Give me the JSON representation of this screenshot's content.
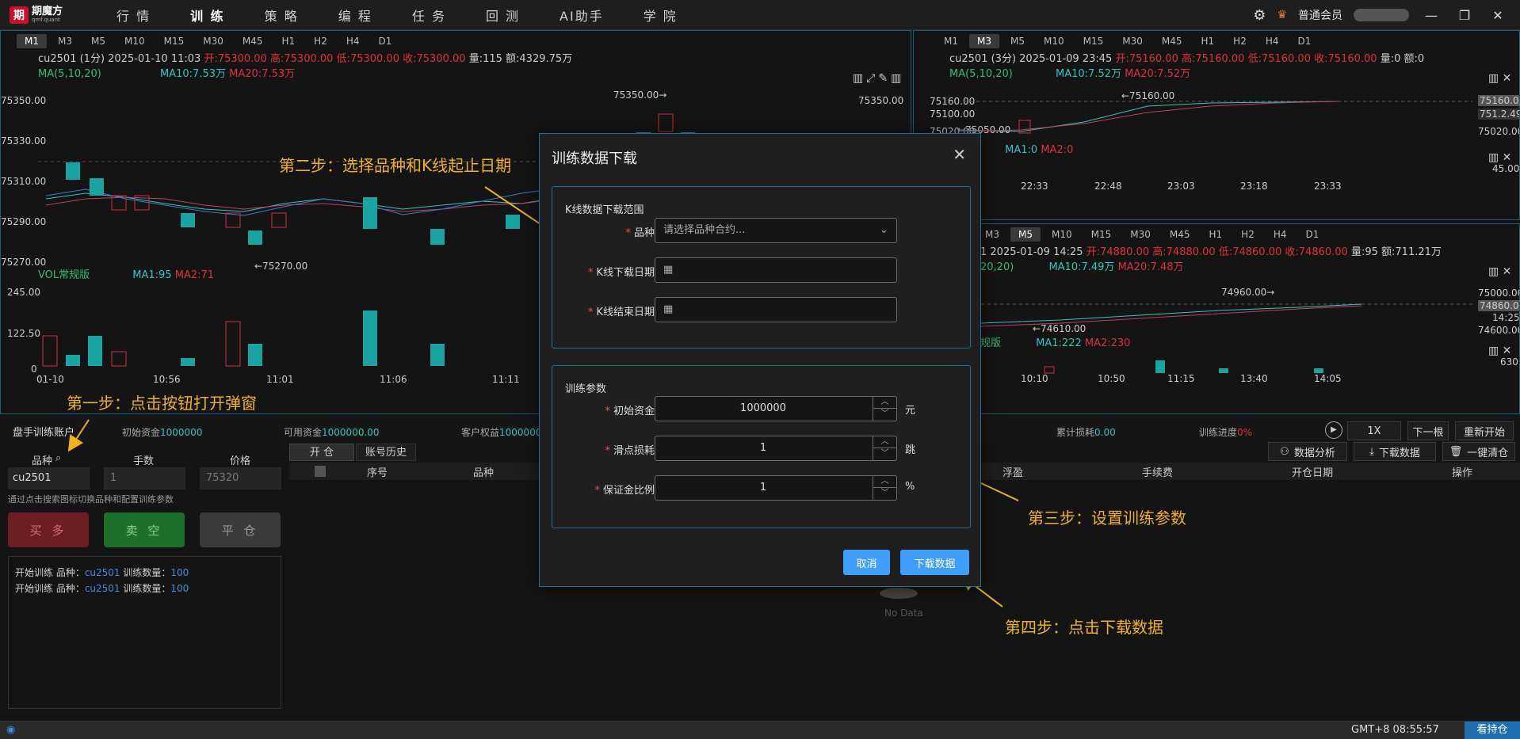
{
  "app": {
    "name": "期魔方",
    "subtitle": "qmf.quant"
  },
  "nav": [
    {
      "label": "行 情"
    },
    {
      "label": "训 练"
    },
    {
      "label": "策 略"
    },
    {
      "label": "编 程"
    },
    {
      "label": "任 务"
    },
    {
      "label": "回 测"
    },
    {
      "label": "AI助手"
    },
    {
      "label": "学 院"
    }
  ],
  "topRight": {
    "member": "普通会员",
    "minimize": "—",
    "maximize": "❐",
    "close": "✕"
  },
  "chartMain": {
    "timeframes": [
      "M1",
      "M3",
      "M5",
      "M10",
      "M15",
      "M30",
      "M45",
      "H1",
      "H2",
      "H4",
      "D1"
    ],
    "info": "cu2501  (1分)  2025-01-10  11:03",
    "open": "开:75300.00",
    "high": "高:75300.00",
    "low": "低:75300.00",
    "close": "收:75300.00",
    "vol": "量:115",
    "amt": "额:4329.75万",
    "ma_label": "MA(5,10,20)",
    "ma10": "MA10:7.53万",
    "ma20": "MA20:7.53万",
    "y": [
      "75350.00",
      "75330.00",
      "75310.00",
      "75290.00",
      "75270.00"
    ],
    "peak": "75350.00→",
    "trough": "←75270.00",
    "rightTop": "75350.00",
    "vol_label": "VOL常规版",
    "vol_ma1": "MA1:95",
    "vol_ma2": "MA2:71",
    "vy": [
      "245.00",
      "122.50",
      "0"
    ],
    "x": [
      "01-10",
      "10:56",
      "11:01",
      "11:06",
      "11:11"
    ]
  },
  "chartTR": {
    "timeframes": [
      "M1",
      "M3",
      "M5",
      "M10",
      "M15",
      "M30",
      "M45",
      "H1",
      "H2",
      "H4",
      "D1"
    ],
    "info": "cu2501  (3分)  2025-01-09  23:45",
    "open": "开:75160.00",
    "high": "高:75160.00",
    "low": "低:75160.00",
    "close": "收:75160.00",
    "vol": "量:0",
    "amt": "额:0",
    "ma_label": "MA(5,10,20)",
    "ma10": "MA10:7.52万",
    "ma20": "MA20:7.52万",
    "y": [
      "75160.00",
      "75100.00",
      "75020.00"
    ],
    "ry": [
      "75160.00",
      "751.2.49",
      "75020.00"
    ],
    "peak": "←75160.00",
    "trough": "←75050.00",
    "vol_label": "规版",
    "vol_ma1": "MA1:0",
    "vol_ma2": "MA2:0",
    "vr": "45.00",
    "x": [
      "22:33",
      "22:48",
      "23:03",
      "23:18",
      "23:33"
    ]
  },
  "chartBR": {
    "timeframes": [
      "M3",
      "M5",
      "M10",
      "M15",
      "M30",
      "M45",
      "H1",
      "H2",
      "H4",
      "D1"
    ],
    "info": "1  2025-01-09  14:25",
    "open": "开:74880.00",
    "high": "高:74880.00",
    "low": "低:74860.00",
    "close": "收:74860.00",
    "vol": "量:95",
    "amt": "额:711.21万",
    "ma_label": "20,20)",
    "ma10": "MA10:7.49万",
    "ma20": "MA20:7.48万",
    "ry": [
      "75000.00",
      "74860.00",
      "14:25",
      "74600.00"
    ],
    "peak": "74960.00→",
    "trough": "←74610.00",
    "vol_label": "规版",
    "vol_ma1": "MA1:222",
    "vol_ma2": "MA2:230",
    "vr": "630",
    "x": [
      "10:10",
      "10:50",
      "11:15",
      "13:40",
      "14:05"
    ]
  },
  "annotations": {
    "step1": "第一步：点击按钮打开弹窗",
    "step2": "第二步：选择品种和K线起止日期",
    "step3": "第三步：设置训练参数",
    "step4": "第四步：点击下载数据"
  },
  "account": {
    "title": "盘手训练账户",
    "init_label": "初始资金",
    "init": "1000000",
    "avail_label": "可用资金",
    "avail": "1000000.00",
    "equity_label": "客户权益",
    "equity": "1000000",
    "loss_label": "累计损耗",
    "loss": "0.00",
    "progress_label": "训练进度",
    "progress": "0%"
  },
  "controls": {
    "speed": "1X",
    "next": "下一根",
    "restart": "重新开始"
  },
  "order": {
    "symbol_label": "品种",
    "qty_label": "手数",
    "price_label": "价格",
    "symbol": "cu2501",
    "qty": "1",
    "price": "75320",
    "hint": "通过点击搜索图标切换品种和配置训练参数",
    "buy": "买 多",
    "sell": "卖 空",
    "close": "平 仓"
  },
  "log": [
    {
      "prefix": "开始训练 品种：",
      "sym": "cu2501",
      "mid": " 训练数量：",
      "n": "100"
    },
    {
      "prefix": "开始训练 品种：",
      "sym": "cu2501",
      "mid": " 训练数量：",
      "n": "100"
    }
  ],
  "tabs": {
    "open": "开 仓",
    "history": "账号历史"
  },
  "tools": {
    "analysis": "数据分析",
    "download": "下载数据",
    "clear": "一键清仓"
  },
  "table": {
    "cols": [
      "序号",
      "品种",
      "浮盈",
      "手续费",
      "开仓日期",
      "操作"
    ],
    "empty": "No Data"
  },
  "status": {
    "time": "GMT+8 08:55:57",
    "hold": "看持仓"
  },
  "modal": {
    "title": "训练数据下载",
    "sec1": "K线数据下载范围",
    "symbol_label": "品种",
    "symbol_ph": "请选择品种合约...",
    "start_label": "K线下载日期",
    "end_label": "K线结束日期",
    "sec2": "训练参数",
    "cap_label": "初始资金",
    "cap": "1000000",
    "cap_unit": "元",
    "slip_label": "滑点损耗",
    "slip": "1",
    "slip_unit": "跳",
    "margin_label": "保证金比例",
    "margin": "1",
    "margin_unit": "%",
    "cancel": "取消",
    "download": "下载数据"
  }
}
